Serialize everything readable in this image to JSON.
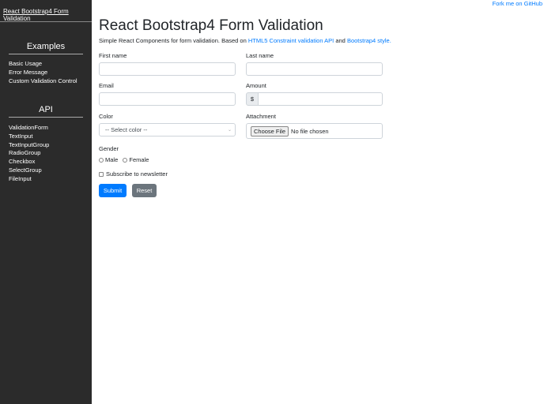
{
  "sidebar": {
    "brand": "React Bootstrap4 Form Validation",
    "examples_title": "Examples",
    "examples": [
      "Basic Usage",
      "Error Message",
      "Custom Validation Control"
    ],
    "api_title": "API",
    "api": [
      "ValidationForm",
      "TextInput",
      "TextInputGroup",
      "RadioGroup",
      "Checkbox",
      "SelectGroup",
      "FileInput"
    ]
  },
  "header": {
    "title": "React Bootstrap4 Form Validation",
    "sub_prefix": "Simple React Components for form validation. Based on ",
    "link1": "HTML5 Constraint validation API",
    "sub_mid": " and ",
    "link2": "Bootstrap4 style."
  },
  "form": {
    "first_name": "First name",
    "last_name": "Last name",
    "email": "Email",
    "amount": "Amount",
    "amount_prefix": "$",
    "color": "Color",
    "color_placeholder": "-- Select color --",
    "attachment": "Attachment",
    "choose_file": "Choose File",
    "no_file": "No file chosen",
    "gender": "Gender",
    "male": "Male",
    "female": "Female",
    "subscribe": "Subscribe to newsletter",
    "submit": "Submit",
    "reset": "Reset"
  },
  "fork": "Fork me on GitHub",
  "colors": {
    "sidebar": "#2b2b2b",
    "primary": "#007bff",
    "secondary": "#6c757d"
  }
}
